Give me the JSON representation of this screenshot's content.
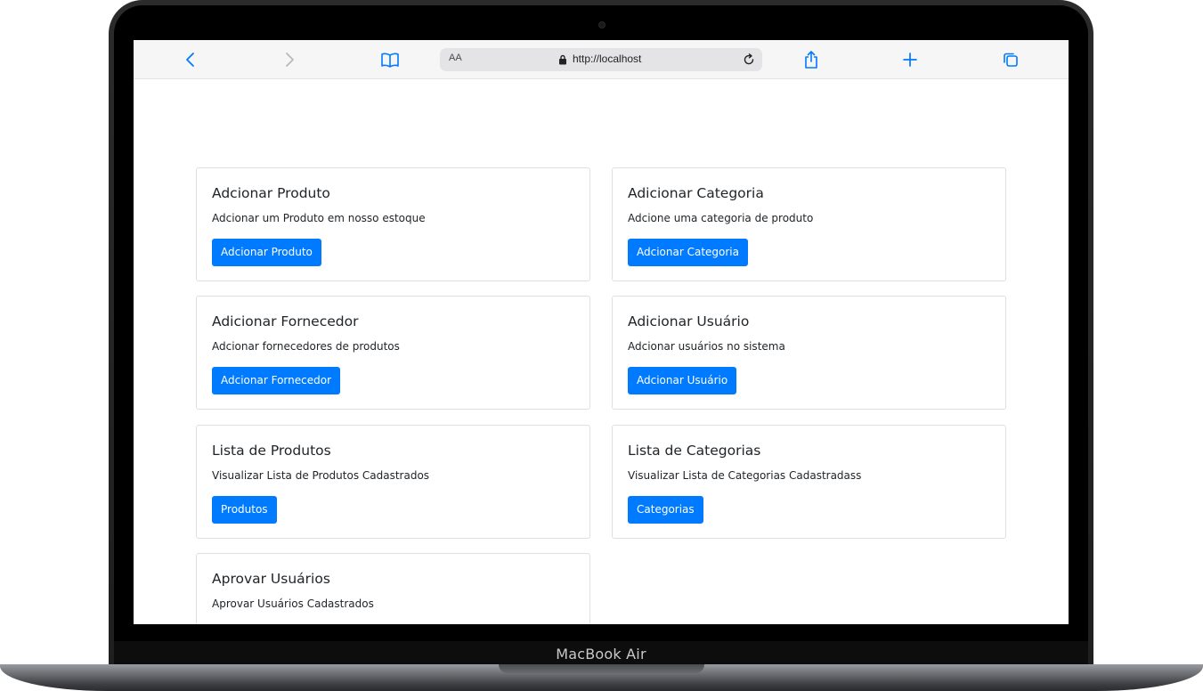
{
  "device": {
    "label": "MacBook Air"
  },
  "browser": {
    "text_size_label": "AA",
    "url": "http://localhost",
    "icons": {
      "back": "chevron-left-icon",
      "forward": "chevron-right-icon",
      "bookmarks": "book-icon",
      "lock": "lock-icon",
      "reload": "reload-icon",
      "share": "share-icon",
      "new_tab": "plus-icon",
      "tabs": "tabs-icon"
    },
    "accent": "#007aff"
  },
  "cards": [
    {
      "title": "Adcionar Produto",
      "text": "Adcionar um Produto em nosso estoque",
      "button": "Adcionar Produto"
    },
    {
      "title": "Adicionar Categoria",
      "text": "Adcione uma categoria de produto",
      "button": "Adcionar Categoria"
    },
    {
      "title": "Adicionar Fornecedor",
      "text": "Adcionar fornecedores de produtos",
      "button": "Adcionar Fornecedor"
    },
    {
      "title": "Adicionar Usuário",
      "text": "Adcionar usuários no sistema",
      "button": "Adcionar Usuário"
    },
    {
      "title": "Lista de Produtos",
      "text": "Visualizar Lista de Produtos Cadastrados",
      "button": "Produtos"
    },
    {
      "title": "Lista de Categorias",
      "text": "Visualizar Lista de Categorias Cadastradass",
      "button": "Categorias"
    },
    {
      "title": "Aprovar Usuários",
      "text": "Aprovar Usuários Cadastrados",
      "button": ""
    }
  ],
  "colors": {
    "primary_button": "#007bff"
  }
}
